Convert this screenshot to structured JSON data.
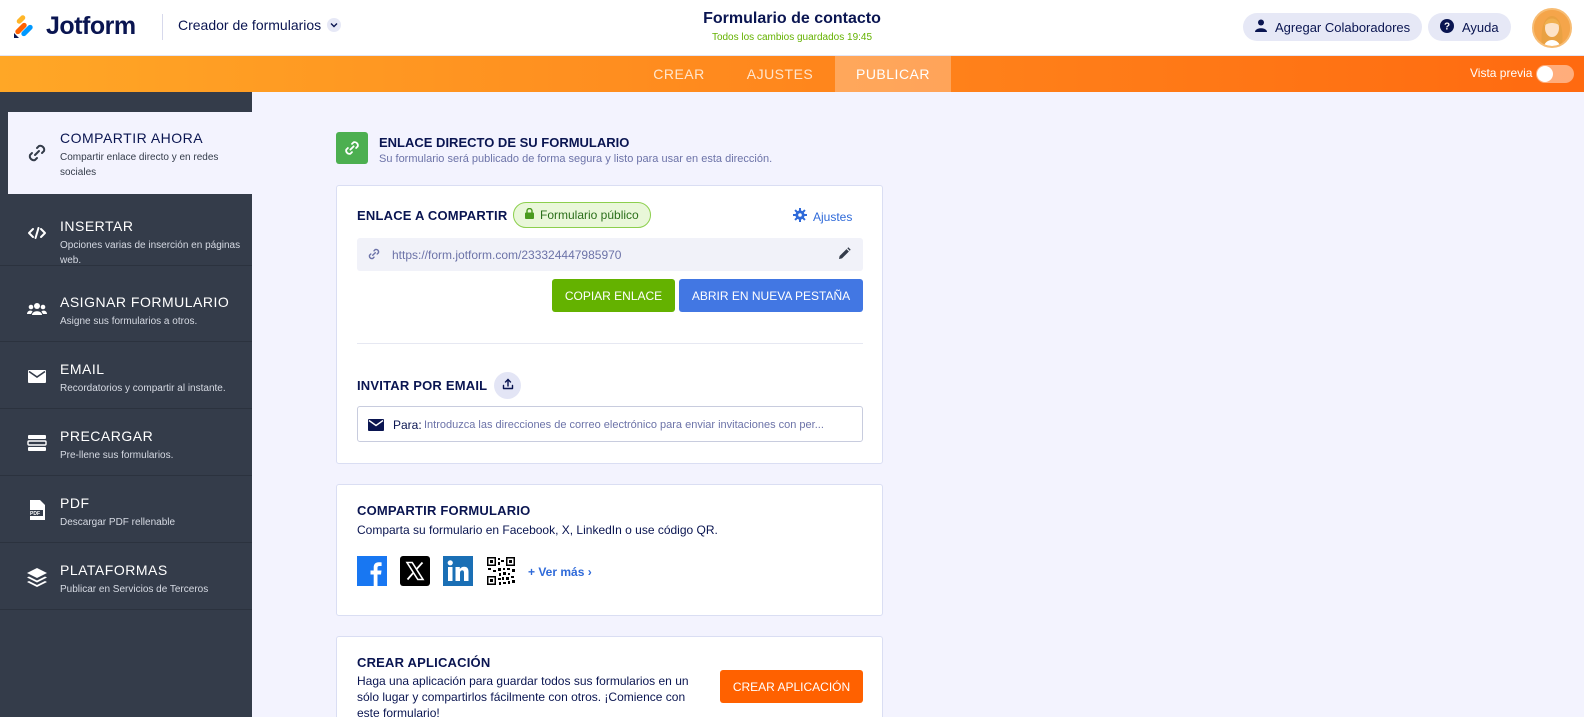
{
  "header": {
    "logo_text": "Jotform",
    "builder_menu": "Creador de formularios",
    "form_title": "Formulario de contacto",
    "save_status": "Todos los cambios guardados 19:45",
    "collaborators_label": "Agregar Colaboradores",
    "help_label": "Ayuda"
  },
  "nav": {
    "tabs": [
      {
        "label": "CREAR"
      },
      {
        "label": "AJUSTES"
      },
      {
        "label": "PUBLICAR"
      }
    ],
    "active_tab": "PUBLICAR",
    "preview_label": "Vista previa",
    "preview_enabled": false
  },
  "sidebar": {
    "items": [
      {
        "title": "COMPARTIR AHORA",
        "desc": "Compartir enlace directo y en redes sociales",
        "icon": "link-icon"
      },
      {
        "title": "INSERTAR",
        "desc": "Opciones varias de inserción en páginas web.",
        "icon": "code-icon"
      },
      {
        "title": "ASIGNAR FORMULARIO",
        "desc": "Asigne sus formularios a otros.",
        "icon": "users-icon"
      },
      {
        "title": "EMAIL",
        "desc": "Recordatorios y compartir al instante.",
        "icon": "envelope-icon"
      },
      {
        "title": "PRECARGAR",
        "desc": "Pre-llene sus formularios.",
        "icon": "prefill-icon"
      },
      {
        "title": "PDF",
        "desc": "Descargar PDF rellenable",
        "icon": "pdf-icon"
      },
      {
        "title": "PLATAFORMAS",
        "desc": "Publicar en Servicios de Terceros",
        "icon": "layers-icon"
      }
    ],
    "active_item": "COMPARTIR AHORA"
  },
  "direct_link": {
    "title": "ENLACE DIRECTO DE SU FORMULARIO",
    "subtitle": "Su formulario será publicado de forma segura y listo para usar en esta dirección."
  },
  "share_link": {
    "label": "ENLACE A COMPARTIR",
    "badge": "Formulario público",
    "settings_label": "Ajustes",
    "url": "https://form.jotform.com/233324447985970",
    "copy_button": "COPIAR ENLACE",
    "open_button": "ABRIR EN NUEVA PESTAÑA"
  },
  "invite": {
    "label": "INVITAR POR EMAIL",
    "to_label": "Para:",
    "placeholder": "Introduzca las direcciones de correo electrónico para enviar invitaciones con per..."
  },
  "share_form": {
    "title": "COMPARTIR FORMULARIO",
    "subtitle": "Comparta su formulario en Facebook, X, LinkedIn o use código QR.",
    "networks": [
      "facebook-icon",
      "x-icon",
      "linkedin-icon",
      "qr-code-icon"
    ],
    "see_more": "+ Ver más ›"
  },
  "create_app": {
    "title": "CREAR APLICACIÓN",
    "description": "Haga una aplicación para guardar todos sus formularios en un sólo lugar y compartirlos fácilmente con otros. ¡Comience con este formulario!",
    "button": "CREAR APLICACIÓN"
  },
  "colors": {
    "navy": "#0a1551",
    "orange_start": "#ffa726",
    "orange_end": "#ff6a10",
    "sidebar_bg": "#343c4a",
    "green": "#64b200",
    "blue": "#4277e3",
    "cta_orange": "#ff6100"
  }
}
